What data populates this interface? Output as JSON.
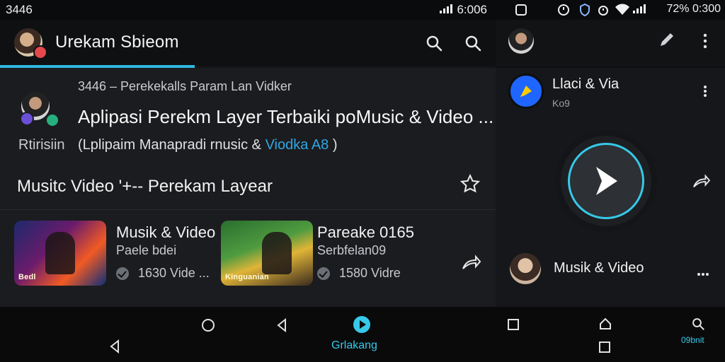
{
  "left_status": {
    "time": "3446",
    "clock": "6:006"
  },
  "appbar": {
    "title": "Urekam Sbieom"
  },
  "content": {
    "breadcrumb": "3446 – Perekekalls Param Lan Vidker",
    "title": "Aplipasi Perekm Layer Terbaiki poMusic & Video ...",
    "left_label": "Rtirisiin",
    "subtitle_prefix": "(Lplipaim Manapradi rnusic &",
    "subtitle_link": "Viodka A8",
    "subtitle_suffix": ")",
    "section_title": "Musitc Video '+-- Perekam Layear",
    "cards": [
      {
        "thumb_label": "Bedl",
        "title": "Musik & Video",
        "subtitle": "Paele bdei",
        "meta": "1630 Vide ..."
      },
      {
        "thumb_label": "Kinguanian",
        "title": "Pareake 0165",
        "subtitle": "Serbfelan09",
        "meta": "1580 Vidre"
      }
    ]
  },
  "left_nav": {
    "center_label": "Grlakang"
  },
  "right_status": {
    "text": "72% 0:300"
  },
  "right_panel": {
    "app_title": "Llaci & Via",
    "app_subtitle": "Ko9",
    "item_title": "Musik & Video"
  },
  "right_nav": {
    "label": "09bnit"
  },
  "colors": {
    "accent": "#2fb8e0",
    "link": "#2fa7e6",
    "badge": "#e5484d",
    "bg": "#141518"
  },
  "icons": [
    "search-icon",
    "star-icon",
    "share-icon",
    "play-icon",
    "pencil-icon",
    "more-vert-icon",
    "more-horiz-icon",
    "home-icon",
    "back-icon",
    "square-icon",
    "wifi-icon",
    "signal-icon",
    "battery-icon"
  ]
}
